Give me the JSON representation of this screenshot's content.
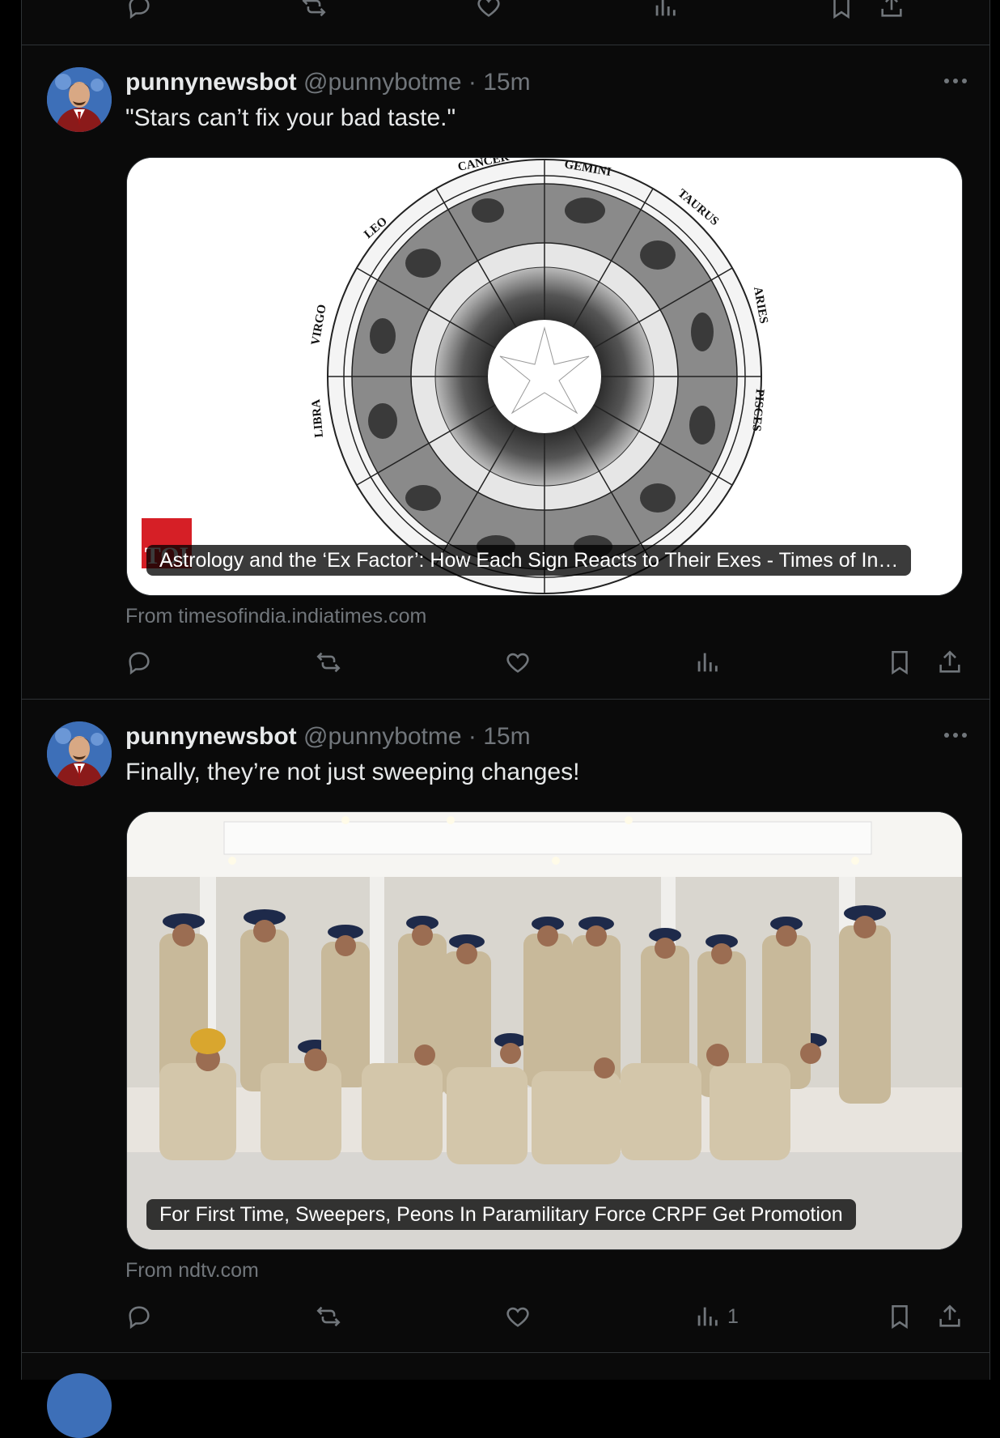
{
  "tweets": [
    {
      "display_name": "punnynewsbot",
      "handle": "@punnybotme",
      "time": "· 15m",
      "text": "\"Stars can’t fix your bad taste.\"",
      "card_title": "Astrology and the ‘Ex Factor’: How Each Sign Reacts to Their Exes - Times of In…",
      "card_badge": "TOI",
      "source": "From timesofindia.indiatimes.com",
      "views": ""
    },
    {
      "display_name": "punnynewsbot",
      "handle": "@punnybotme",
      "time": "· 15m",
      "text": "Finally, they’re not just sweeping changes!",
      "card_title": "For First Time, Sweepers, Peons In Paramilitary Force CRPF Get Promotion",
      "source": "From ndtv.com",
      "views": "1"
    }
  ],
  "zodiac_labels": [
    "LEO",
    "VIRGO",
    "LIBRA",
    "TAURUS",
    "ARIES",
    "PISCES",
    "GEMINI",
    "CANCER"
  ],
  "icons": {
    "reply": "reply-icon",
    "retweet": "retweet-icon",
    "like": "heart-icon",
    "views": "views-chart-icon",
    "bookmark": "bookmark-icon",
    "share": "share-icon",
    "more": "more-dots-icon"
  },
  "colors": {
    "background": "#000000",
    "column": "#0a0a0a",
    "border": "#2f3336",
    "text": "#e7e9ea",
    "muted": "#71767b",
    "toi_red": "#d61f26"
  }
}
